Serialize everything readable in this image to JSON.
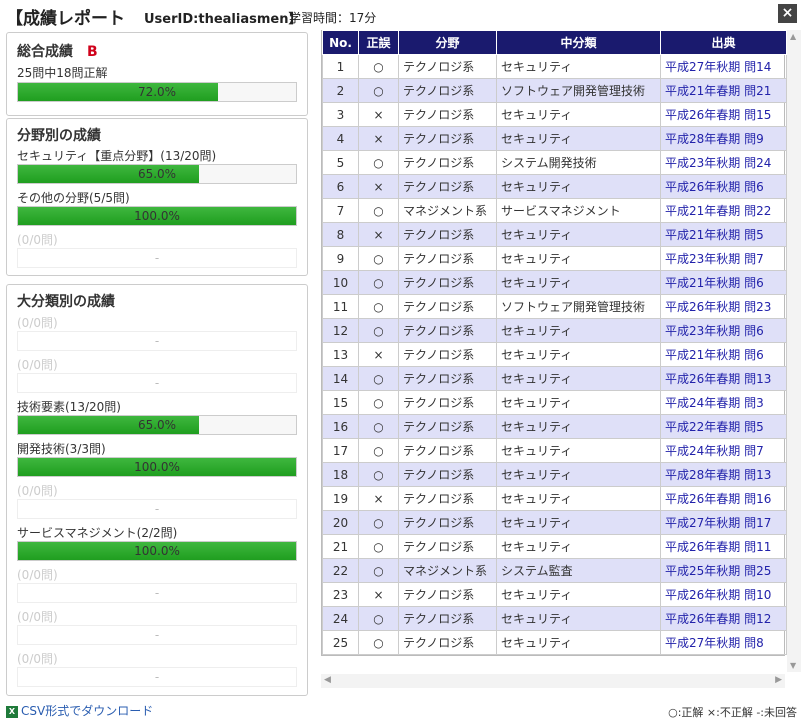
{
  "header": {
    "title": "【成績レポート",
    "userid": "UserID:thealiasmen】",
    "study_time": "学習時間：17分",
    "close_label": "×"
  },
  "overall": {
    "title": "総合成績",
    "grade": "B",
    "summary": "25問中18問正解",
    "percent_text": "72.0%",
    "percent": 72.0
  },
  "field": {
    "title": "分野別の成績",
    "items": [
      {
        "label": "セキュリティ【重点分野】(13/20問)",
        "text": "65.0%",
        "percent": 65.0
      },
      {
        "label": "その他の分野(5/5問)",
        "text": "100.0%",
        "percent": 100.0
      },
      {
        "label": "(0/0問)",
        "text": "-",
        "percent": 0
      }
    ]
  },
  "category": {
    "title": "大分類別の成績",
    "items": [
      {
        "label": "(0/0問)",
        "text": "-",
        "percent": 0
      },
      {
        "label": "(0/0問)",
        "text": "-",
        "percent": 0
      },
      {
        "label": "技術要素(13/20問)",
        "text": "65.0%",
        "percent": 65.0
      },
      {
        "label": "開発技術(3/3問)",
        "text": "100.0%",
        "percent": 100.0
      },
      {
        "label": "(0/0問)",
        "text": "-",
        "percent": 0
      },
      {
        "label": "サービスマネジメント(2/2問)",
        "text": "100.0%",
        "percent": 100.0
      },
      {
        "label": "(0/0問)",
        "text": "-",
        "percent": 0
      },
      {
        "label": "(0/0問)",
        "text": "-",
        "percent": 0
      },
      {
        "label": "(0/0問)",
        "text": "-",
        "percent": 0
      }
    ]
  },
  "table": {
    "headers": [
      "No.",
      "正誤",
      "分野",
      "中分類",
      "出典"
    ],
    "rows": [
      [
        "1",
        "○",
        "テクノロジ系",
        "セキュリティ",
        "平成27年秋期 問14"
      ],
      [
        "2",
        "○",
        "テクノロジ系",
        "ソフトウェア開発管理技術",
        "平成21年春期 問21"
      ],
      [
        "3",
        "×",
        "テクノロジ系",
        "セキュリティ",
        "平成26年春期 問15"
      ],
      [
        "4",
        "×",
        "テクノロジ系",
        "セキュリティ",
        "平成28年春期 問9"
      ],
      [
        "5",
        "○",
        "テクノロジ系",
        "システム開発技術",
        "平成23年秋期 問24"
      ],
      [
        "6",
        "×",
        "テクノロジ系",
        "セキュリティ",
        "平成26年秋期 問6"
      ],
      [
        "7",
        "○",
        "マネジメント系",
        "サービスマネジメント",
        "平成21年春期 問22"
      ],
      [
        "8",
        "×",
        "テクノロジ系",
        "セキュリティ",
        "平成21年秋期 問5"
      ],
      [
        "9",
        "○",
        "テクノロジ系",
        "セキュリティ",
        "平成23年秋期 問7"
      ],
      [
        "10",
        "○",
        "テクノロジ系",
        "セキュリティ",
        "平成21年秋期 問6"
      ],
      [
        "11",
        "○",
        "テクノロジ系",
        "ソフトウェア開発管理技術",
        "平成26年秋期 問23"
      ],
      [
        "12",
        "○",
        "テクノロジ系",
        "セキュリティ",
        "平成23年秋期 問6"
      ],
      [
        "13",
        "×",
        "テクノロジ系",
        "セキュリティ",
        "平成21年秋期 問6"
      ],
      [
        "14",
        "○",
        "テクノロジ系",
        "セキュリティ",
        "平成26年春期 問13"
      ],
      [
        "15",
        "○",
        "テクノロジ系",
        "セキュリティ",
        "平成24年春期 問3"
      ],
      [
        "16",
        "○",
        "テクノロジ系",
        "セキュリティ",
        "平成22年春期 問5"
      ],
      [
        "17",
        "○",
        "テクノロジ系",
        "セキュリティ",
        "平成24年秋期 問7"
      ],
      [
        "18",
        "○",
        "テクノロジ系",
        "セキュリティ",
        "平成28年春期 問13"
      ],
      [
        "19",
        "×",
        "テクノロジ系",
        "セキュリティ",
        "平成26年春期 問16"
      ],
      [
        "20",
        "○",
        "テクノロジ系",
        "セキュリティ",
        "平成27年秋期 問17"
      ],
      [
        "21",
        "○",
        "テクノロジ系",
        "セキュリティ",
        "平成26年春期 問11"
      ],
      [
        "22",
        "○",
        "マネジメント系",
        "システム監査",
        "平成25年秋期 問25"
      ],
      [
        "23",
        "×",
        "テクノロジ系",
        "セキュリティ",
        "平成26年秋期 問10"
      ],
      [
        "24",
        "○",
        "テクノロジ系",
        "セキュリティ",
        "平成26年春期 問12"
      ],
      [
        "25",
        "○",
        "テクノロジ系",
        "セキュリティ",
        "平成27年秋期 問8"
      ]
    ]
  },
  "footer": {
    "download_label": "CSV形式でダウンロード",
    "legend": "○:正解 ×:不正解 -:未回答"
  },
  "colors": {
    "bar_fill": "#2aa82a",
    "table_header": "#1a1a6e",
    "row_alt": "#dfe0f8",
    "grade": "#d0021b",
    "link": "#2a5db0"
  }
}
